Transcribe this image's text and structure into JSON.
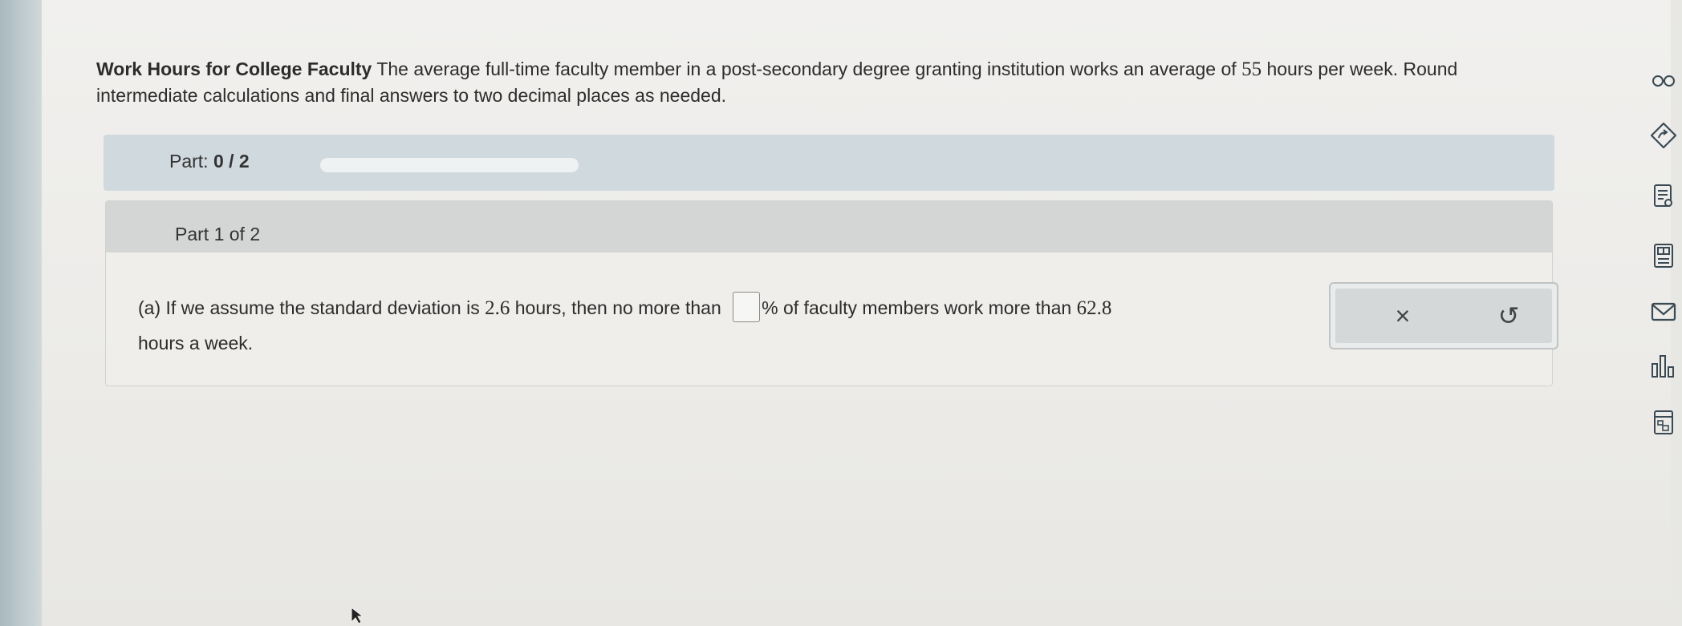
{
  "problem": {
    "title": "Work Hours for College Faculty",
    "text_a": "The average full-time faculty member in a post-secondary degree granting institution works an average of ",
    "avg_hours": "55",
    "text_b": " hours per week. Round intermediate calculations and final answers to two decimal places as needed."
  },
  "progress": {
    "label": "Part:",
    "value": "0 / 2",
    "fraction": 0
  },
  "part": {
    "header": "Part 1 of 2"
  },
  "question": {
    "text_a": "(a) If we assume the standard deviation is ",
    "sd": "2.6",
    "text_b": " hours, then no more than ",
    "answer_value": "",
    "text_c": "% of faculty members work more than ",
    "threshold": "62.8",
    "text_d": "hours a week."
  },
  "actions": {
    "clear_symbol": "×",
    "undo_symbol": "↺"
  },
  "icons": {
    "tool_1": "glasses-icon",
    "tool_2": "tag-arrow-icon",
    "tool_3": "notes-icon",
    "tool_4": "calculator-icon",
    "tool_5": "mail-icon",
    "tool_6": "bar-chart-icon",
    "tool_7": "table-icon"
  },
  "colors": {
    "part_bar": "#cfd9de",
    "part_header": "#d4d6d6",
    "icon": "#3a4a55"
  }
}
